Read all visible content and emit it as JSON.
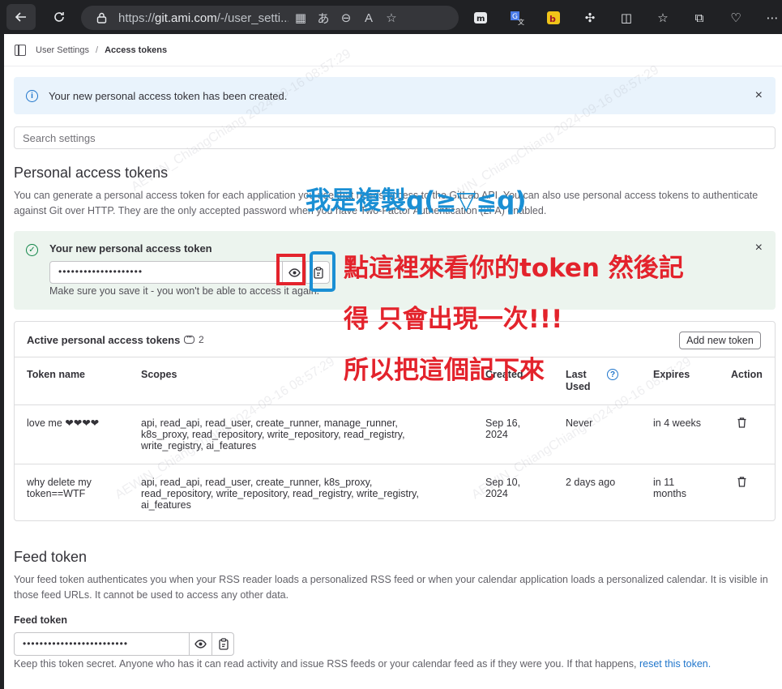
{
  "browser": {
    "url_prefix": "https://",
    "url_host": "git.ami.com",
    "url_path": "/-/user_setti..."
  },
  "breadcrumb": {
    "parent": "User Settings",
    "separator": "/",
    "current": "Access tokens"
  },
  "info_alert": {
    "message": "Your new personal access token has been created.",
    "close": "×"
  },
  "search": {
    "placeholder": "Search settings"
  },
  "pat_section": {
    "heading": "Personal access tokens",
    "description": "You can generate a personal access token for each application you use that needs access to the GitLab API. You can also use personal access tokens to authenticate against Git over HTTP. They are the only accepted password when you have Two-Factor Authentication (2FA) enabled."
  },
  "new_token": {
    "title": "Your new personal access token",
    "masked_value": "••••••••••••••••••••",
    "hint": "Make sure you save it - you won't be able to access it again.",
    "close": "×"
  },
  "active_tokens": {
    "title": "Active personal access tokens",
    "count": "2",
    "add_button": "Add new token",
    "columns": {
      "name": "Token name",
      "scopes": "Scopes",
      "created": "Created",
      "last_used_1": "Last",
      "last_used_2": "Used",
      "expires": "Expires",
      "action": "Action"
    },
    "rows": [
      {
        "name_1": "love me ❤❤❤❤",
        "name_2": "",
        "scopes_1": "api, read_api, read_user, create_runner, manage_runner,",
        "scopes_2": "k8s_proxy, read_repository, write_repository, read_registry,",
        "scopes_3": "write_registry, ai_features",
        "created_1": "Sep 16,",
        "created_2": "2024",
        "last_used": "Never",
        "expires_1": "in 4 weeks",
        "expires_2": ""
      },
      {
        "name_1": "why delete my",
        "name_2": "token==WTF",
        "scopes_1": "api, read_api, read_user, create_runner, k8s_proxy,",
        "scopes_2": "read_repository, write_repository, read_registry, write_registry,",
        "scopes_3": "ai_features",
        "created_1": "Sep 10,",
        "created_2": "2024",
        "last_used": "2 days ago",
        "expires_1": "in 11",
        "expires_2": "months"
      }
    ]
  },
  "feed_section": {
    "heading": "Feed token",
    "description": "Your feed token authenticates you when your RSS reader loads a personalized RSS feed or when your calendar application loads a personalized calendar. It is visible in those feed URLs. It cannot be used to access any other data.",
    "label": "Feed token",
    "masked_value": "•••••••••••••••••••••••••",
    "note": "Keep this token secret. Anyone who has it can read activity and issue RSS feeds or your calendar feed as if they were you. If that happens,",
    "reset_link": "reset this token."
  },
  "annotations": {
    "blue_text": "我是複製q(≧▽≦q)",
    "red_line_1": "點這裡來看你的token 然後記",
    "red_line_2": "得 只會出現一次!!!",
    "red_line_3": "所以把這個記下來"
  },
  "colors": {
    "link": "#1f75cb",
    "info_bg": "#e9f3fc",
    "success_bg": "#ecf4ee",
    "annotation_red": "#e3232c",
    "annotation_blue": "#1a8fd4"
  }
}
